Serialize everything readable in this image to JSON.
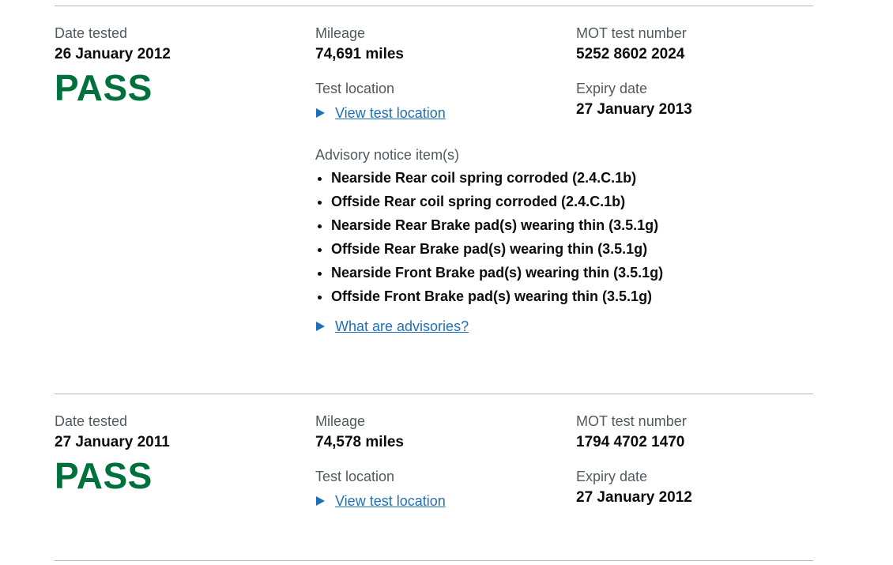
{
  "records": [
    {
      "date_label": "Date tested",
      "date": "26 January 2012",
      "result": "PASS",
      "mileage_label": "Mileage",
      "mileage": "74,691 miles",
      "location_label": "Test location",
      "location_link": "View test location",
      "advisory_label": "Advisory notice item(s)",
      "advisories": [
        "Nearside Rear coil spring corroded (2.4.C.1b)",
        "Offside Rear coil spring corroded (2.4.C.1b)",
        "Nearside Rear Brake pad(s) wearing thin (3.5.1g)",
        "Offside Rear Brake pad(s) wearing thin (3.5.1g)",
        "Nearside Front Brake pad(s) wearing thin (3.5.1g)",
        "Offside Front Brake pad(s) wearing thin (3.5.1g)"
      ],
      "advisory_help_link": "What are advisories?",
      "test_number_label": "MOT test number",
      "test_number": "5252 8602 2024",
      "expiry_label": "Expiry date",
      "expiry": "27 January 2013"
    },
    {
      "date_label": "Date tested",
      "date": "27 January 2011",
      "result": "PASS",
      "mileage_label": "Mileage",
      "mileage": "74,578 miles",
      "location_label": "Test location",
      "location_link": "View test location",
      "test_number_label": "MOT test number",
      "test_number": "1794 4702 1470",
      "expiry_label": "Expiry date",
      "expiry": "27 January 2012"
    }
  ],
  "colors": {
    "pass": "#00703c",
    "link": "#1d70b8",
    "label": "#505a5f",
    "divider": "#b1b4b6"
  }
}
